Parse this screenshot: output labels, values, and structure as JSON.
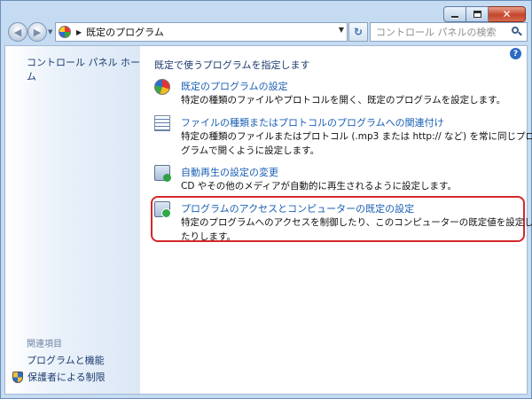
{
  "address": {
    "breadcrumb": "既定のプログラム"
  },
  "search": {
    "placeholder": "コントロール パネルの検索"
  },
  "sidebar": {
    "home": "コントロール パネル ホーム",
    "related_heading": "関連項目",
    "links": [
      "プログラムと機能",
      "保護者による制限"
    ]
  },
  "main": {
    "heading": "既定で使うプログラムを指定します",
    "tasks": [
      {
        "icon": "default-programs-icon",
        "title": "既定のプログラムの設定",
        "desc": "特定の種類のファイルやプロトコルを開く、既定のプログラムを設定します。"
      },
      {
        "icon": "file-association-icon",
        "title": "ファイルの種類またはプロトコルのプログラムへの関連付け",
        "desc": "特定の種類のファイルまたはプロトコル (.mp3 または http:// など) を常に同じプログラムで開くように設定します。"
      },
      {
        "icon": "autoplay-icon",
        "title": "自動再生の設定の変更",
        "desc": "CD やその他のメディアが自動的に再生されるように設定します。"
      },
      {
        "icon": "program-access-icon",
        "title": "プログラムのアクセスとコンピューターの既定の設定",
        "desc": "特定のプログラムへのアクセスを制御したり、このコンピューターの既定値を設定したりします。"
      }
    ]
  },
  "highlight_color": "#d3282d"
}
